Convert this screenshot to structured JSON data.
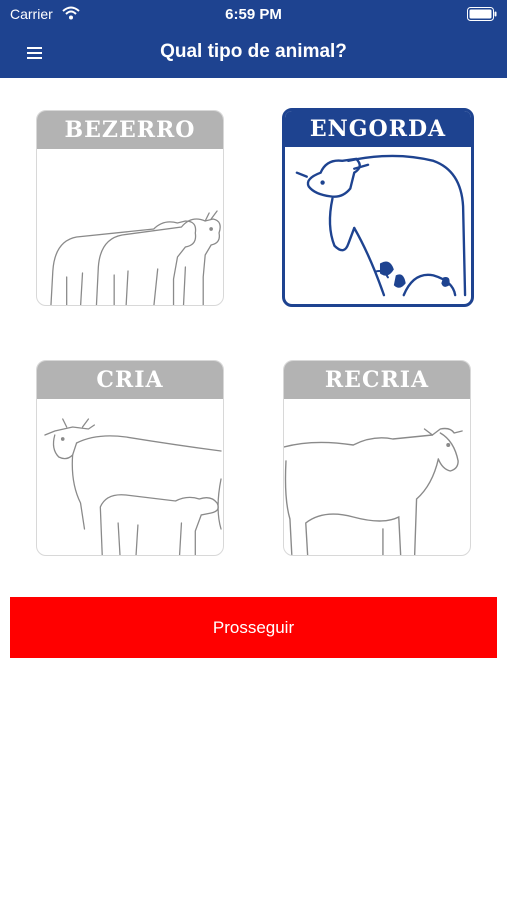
{
  "status_bar": {
    "carrier": "Carrier",
    "time": "6:59 PM",
    "icons": [
      "wifi-icon",
      "battery-icon"
    ]
  },
  "nav": {
    "title": "Qual tipo de animal?",
    "menu_icon": "hamburger-menu-icon"
  },
  "options": [
    {
      "label": "BEZERRO",
      "selected": false
    },
    {
      "label": "ENGORDA",
      "selected": true
    },
    {
      "label": "CRIA",
      "selected": false
    },
    {
      "label": "RECRIA",
      "selected": false
    }
  ],
  "proceed_label": "Prosseguir",
  "colors": {
    "primary": "#1e4390",
    "card_header_gray": "#b3b3b3",
    "proceed": "#ff0000",
    "line_art": "#8a8a8a"
  }
}
